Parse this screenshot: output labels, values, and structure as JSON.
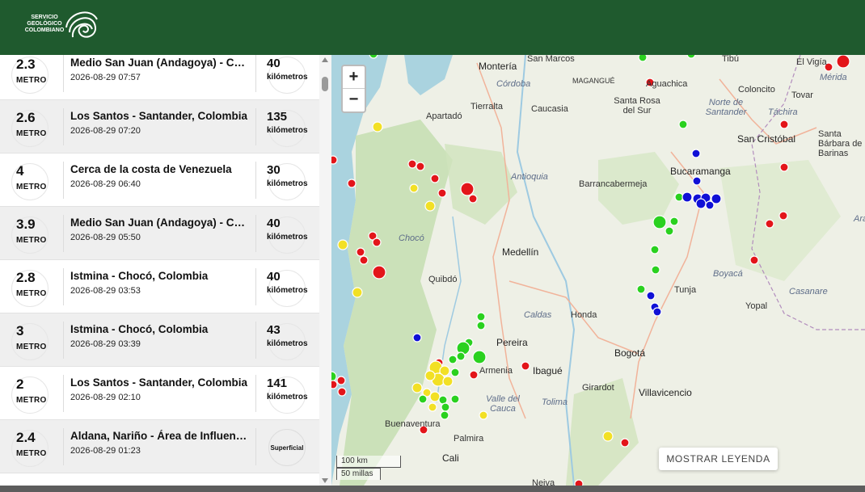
{
  "header": {
    "logo_line1": "SERVICIO",
    "logo_line2": "GEOLÓGICO",
    "logo_line3": "COLOMBIANO",
    "color": "#1f5a2e"
  },
  "events": [
    {
      "mag": "2.3",
      "mag_type": "METRO",
      "place": "Medio San Juan (Andagoya) - Choc...",
      "datetime": "2026-08-29 07:57",
      "depth": "40",
      "depth_unit": "kilómetros"
    },
    {
      "mag": "2.6",
      "mag_type": "METRO",
      "place": "Los Santos - Santander, Colombia",
      "datetime": "2026-08-29 07:20",
      "depth": "135",
      "depth_unit": "kilómetros"
    },
    {
      "mag": "4",
      "mag_type": "METRO",
      "place": "Cerca de la costa de Venezuela",
      "datetime": "2026-08-29 06:40",
      "depth": "30",
      "depth_unit": "kilómetros"
    },
    {
      "mag": "3.9",
      "mag_type": "METRO",
      "place": "Medio San Juan (Andagoya) - Choc...",
      "datetime": "2026-08-29 05:50",
      "depth": "40",
      "depth_unit": "kilómetros"
    },
    {
      "mag": "2.8",
      "mag_type": "METRO",
      "place": "Istmina - Chocó, Colombia",
      "datetime": "2026-08-29 03:53",
      "depth": "40",
      "depth_unit": "kilómetros"
    },
    {
      "mag": "3",
      "mag_type": "METRO",
      "place": "Istmina - Chocó, Colombia",
      "datetime": "2026-08-29 03:39",
      "depth": "43",
      "depth_unit": "kilómetros"
    },
    {
      "mag": "2",
      "mag_type": "METRO",
      "place": "Los Santos - Santander, Colombia",
      "datetime": "2026-08-29 02:10",
      "depth": "141",
      "depth_unit": "kilómetros"
    },
    {
      "mag": "2.4",
      "mag_type": "METRO",
      "place": "Aldana, Nariño - Área de Influencia ...",
      "datetime": "2026-08-29 01:23",
      "depth_superficial": "Superficial"
    }
  ],
  "map": {
    "zoom_in": "+",
    "zoom_out": "−",
    "legend_button": "MOSTRAR LEYENDA",
    "scale_km": "100 km",
    "scale_mi": "50 millas",
    "labels": {
      "monteria": "Montería",
      "sanmarcos": "San Marcos",
      "tibu": "Tibú",
      "elvigia": "El Vigía",
      "merida": "Mérida",
      "magangue": "MAGANGUÉ",
      "cordoba": "Córdoba",
      "aguachica": "Aguachica",
      "colonc": "Coloncito",
      "tovar": "Tovar",
      "tierralta": "Tierralta",
      "caucasia": "Caucasia",
      "santarosa": "Santa Rosa del Sur",
      "nortesantander": "Norte de Santander",
      "tachira": "Táchira",
      "apartado": "Apartadó",
      "santabarbara": "Santa Bárbara de Barinas",
      "sancristobal": "San Cristóbal",
      "antioquia": "Antioquia",
      "bucaramanga": "Bucaramanga",
      "barranca": "Barrancabermeja",
      "arauca": "Arau",
      "choco": "Chocó",
      "medellin": "Medellín",
      "boyaca": "Boyacá",
      "quibdo": "Quibdó",
      "tunja": "Tunja",
      "yopal": "Yopal",
      "casanare": "Casanare",
      "caldas": "Caldas",
      "honda": "Honda",
      "pereira": "Pereira",
      "bogota": "Bogotá",
      "armenia": "Armenia",
      "ibague": "Ibagué",
      "tolima": "Tolima",
      "girardot": "Girardot",
      "villavicencio": "Villavicencio",
      "valle": "Valle del Cauca",
      "buenaventura": "Buenaventura",
      "palmira": "Palmira",
      "cali": "Cali",
      "neiva": "Neiva"
    }
  },
  "colors": {
    "red": "#e3151a",
    "green": "#2ad11f",
    "yellow": "#f2e025",
    "blue": "#1010d6"
  }
}
